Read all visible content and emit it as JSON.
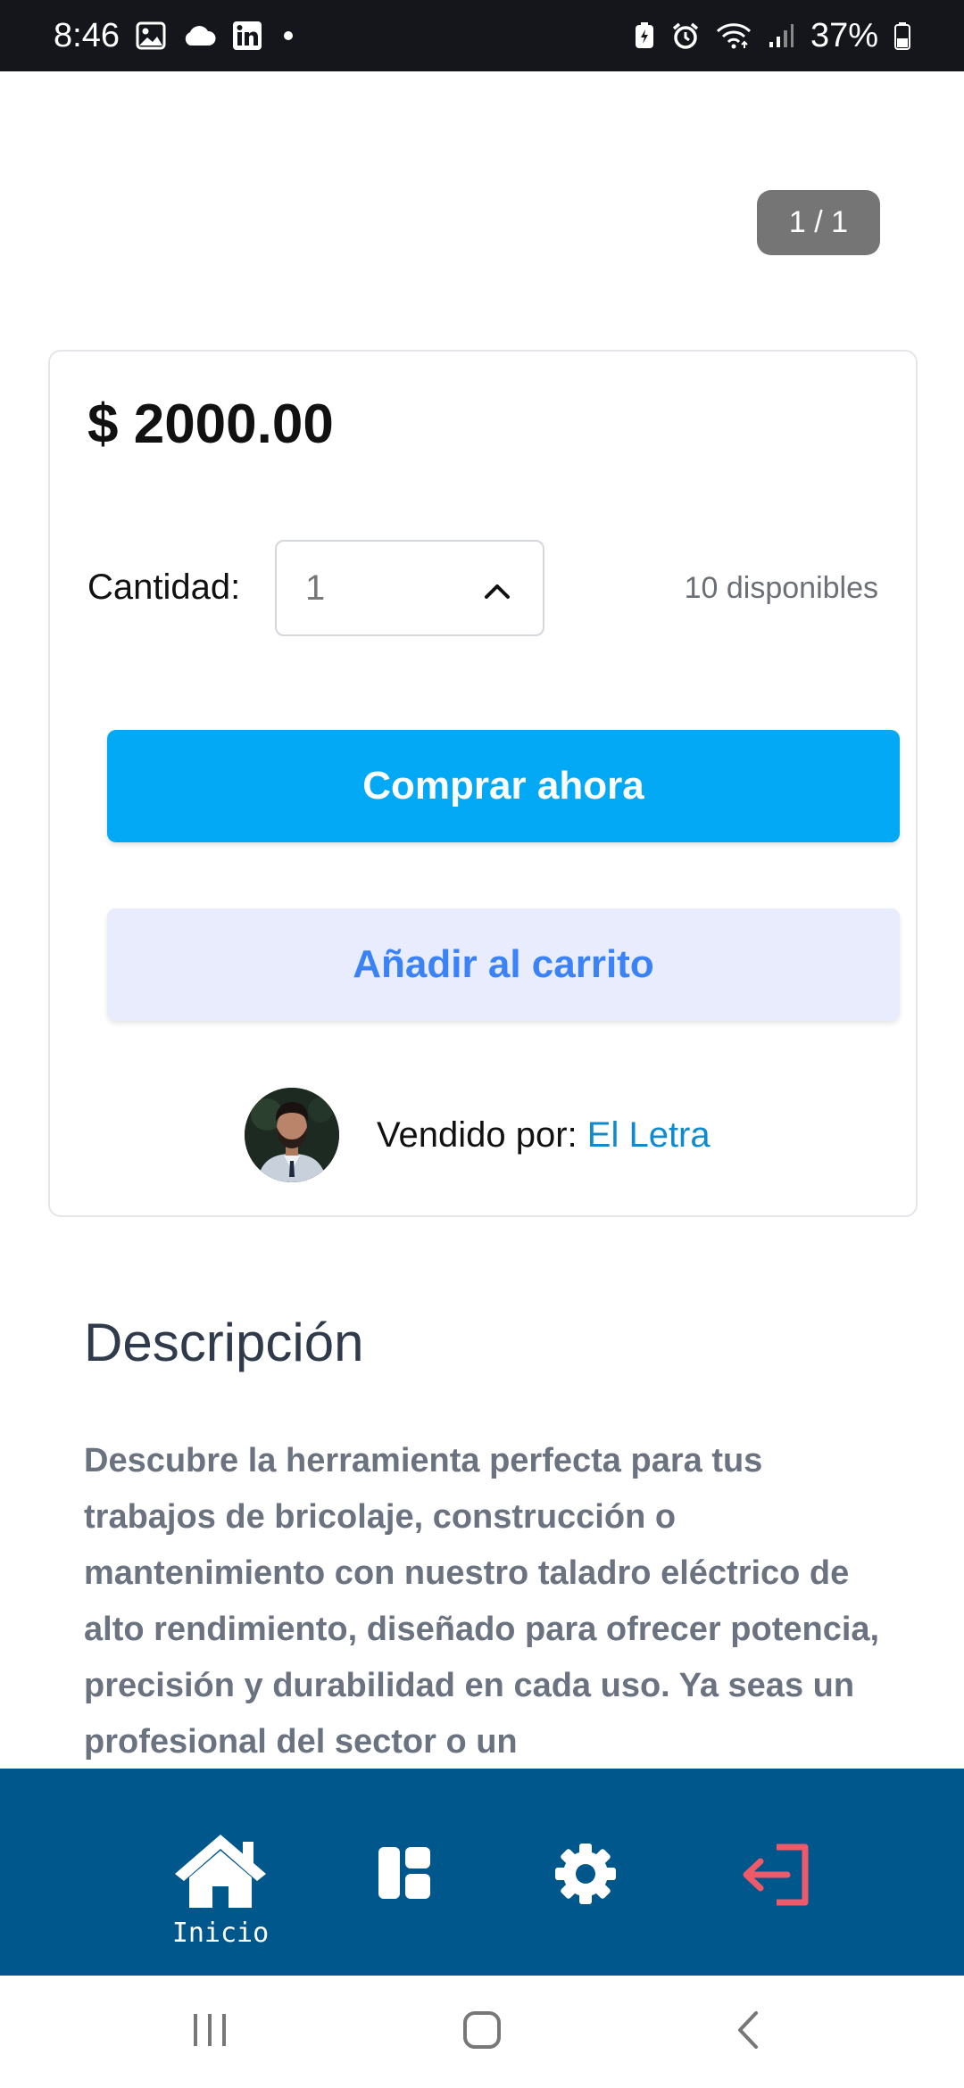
{
  "status_bar": {
    "time": "8:46",
    "battery": "37%",
    "left_icons": [
      "gallery-icon",
      "cloud-icon",
      "linkedin-icon",
      "dot-icon"
    ],
    "right_icons": [
      "battery-saver-icon",
      "alarm-icon",
      "wifi-icon",
      "signal-icon",
      "battery-icon"
    ]
  },
  "gallery": {
    "counter": "1 / 1"
  },
  "product": {
    "price": "$ 2000.00",
    "quantity_label": "Cantidad:",
    "quantity_value": "1",
    "available": "10 disponibles",
    "buy_now_label": "Comprar ahora",
    "add_to_cart_label": "Añadir al carrito",
    "sold_by_label": "Vendido por:",
    "seller_name": "El Letra"
  },
  "description": {
    "title": "Descripción",
    "text": "Descubre la herramienta perfecta para tus trabajos de bricolaje, construcción o mantenimiento con nuestro taladro eléctrico de alto rendimiento, diseñado para ofrecer potencia, precisión y durabilidad en cada uso. Ya seas un profesional del sector o un"
  },
  "bottom_nav": {
    "items": [
      {
        "icon": "home-icon",
        "label": "Inicio"
      },
      {
        "icon": "dashboard-icon",
        "label": ""
      },
      {
        "icon": "gear-icon",
        "label": ""
      },
      {
        "icon": "logout-icon",
        "label": ""
      }
    ],
    "colors": {
      "background": "#00578b",
      "logout": "#ef5a6a"
    }
  },
  "system_nav": [
    "recent-apps-icon",
    "home-button-icon",
    "back-icon"
  ],
  "colors": {
    "buy_button": "#03a9f4",
    "cart_button_bg": "#e8ecfc",
    "cart_button_text": "#3b82f6",
    "seller_link": "#0e8ad0"
  }
}
